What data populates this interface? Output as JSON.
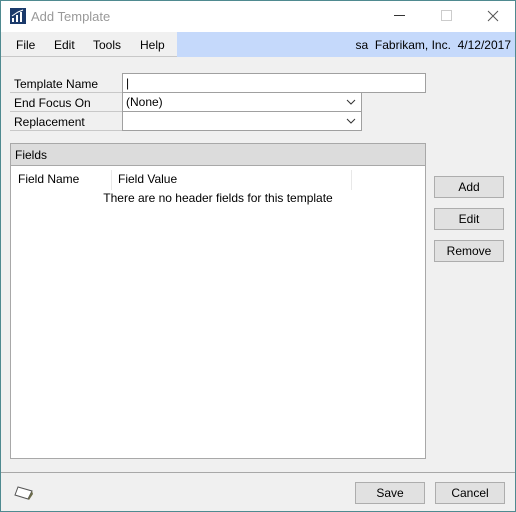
{
  "window": {
    "title": "Add Template",
    "app_icon": "chart-bars-icon"
  },
  "menu": {
    "items": [
      "File",
      "Edit",
      "Tools",
      "Help"
    ],
    "user": "sa",
    "company": "Fabrikam, Inc.",
    "date": "4/12/2017"
  },
  "form": {
    "template_name": {
      "label": "Template Name",
      "value": "|"
    },
    "end_focus_on": {
      "label": "End Focus On",
      "value": "(None)"
    },
    "replacement": {
      "label": "Replacement",
      "value": ""
    }
  },
  "fields": {
    "title": "Fields",
    "columns": [
      "Field Name",
      "Field Value"
    ],
    "empty_message": "There are no header fields for this template"
  },
  "buttons": {
    "add": "Add",
    "edit": "Edit",
    "remove": "Remove",
    "save": "Save",
    "cancel": "Cancel"
  },
  "colors": {
    "userbar": "#c5d9fb",
    "border": "#4f8a90"
  }
}
